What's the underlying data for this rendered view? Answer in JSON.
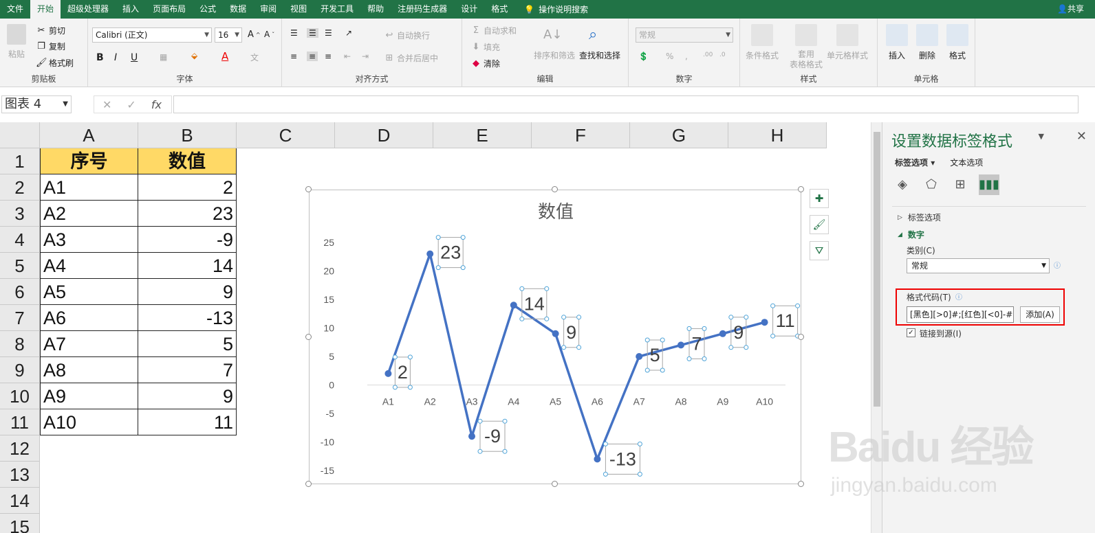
{
  "menu": {
    "tabs": [
      "文件",
      "开始",
      "超级处理器",
      "插入",
      "页面布局",
      "公式",
      "数据",
      "审阅",
      "视图",
      "开发工具",
      "帮助",
      "注册码生成器",
      "设计",
      "格式"
    ],
    "active_tab": "开始",
    "search": "操作说明搜索",
    "share": "共享"
  },
  "ribbon": {
    "clipboard": {
      "paste": "粘贴",
      "cut": "剪切",
      "copy": "复制",
      "format_painter": "格式刷",
      "name": "剪贴板"
    },
    "font": {
      "font_name": "Calibri (正文)",
      "font_size": "16",
      "bold": "B",
      "italic": "I",
      "underline": "U",
      "name": "字体"
    },
    "align": {
      "wrap": "自动换行",
      "merge": "合并后居中",
      "name": "对齐方式"
    },
    "edit": {
      "autosum": "自动求和",
      "fill": "填充",
      "clear": "清除",
      "sort": "排序和筛选",
      "find": "查找和选择",
      "name": "编辑"
    },
    "number": {
      "format": "常规",
      "name": "数字"
    },
    "styles": {
      "cond": "条件格式",
      "table": "套用\n表格格式",
      "cell": "单元格样式",
      "name": "样式"
    },
    "cells": {
      "insert": "插入",
      "delete": "删除",
      "format": "格式",
      "name": "单元格"
    }
  },
  "formula_bar": {
    "name_box": "图表 4",
    "fx": "fx",
    "value": ""
  },
  "sheet": {
    "columns": [
      "A",
      "B",
      "C",
      "D",
      "E",
      "F",
      "G",
      "H"
    ],
    "rows": [
      "1",
      "2",
      "3",
      "4",
      "5",
      "6",
      "7",
      "8",
      "9",
      "10",
      "11",
      "12",
      "13",
      "14",
      "15"
    ],
    "header": [
      "序号",
      "数值"
    ],
    "data": [
      [
        "A1",
        "2"
      ],
      [
        "A2",
        "23"
      ],
      [
        "A3",
        "-9"
      ],
      [
        "A4",
        "14"
      ],
      [
        "A5",
        "9"
      ],
      [
        "A6",
        "-13"
      ],
      [
        "A7",
        "5"
      ],
      [
        "A8",
        "7"
      ],
      [
        "A9",
        "9"
      ],
      [
        "A10",
        "11"
      ]
    ]
  },
  "chart_data": {
    "type": "line",
    "title": "数值",
    "categories": [
      "A1",
      "A2",
      "A3",
      "A4",
      "A5",
      "A6",
      "A7",
      "A8",
      "A9",
      "A10"
    ],
    "series": [
      {
        "values": [
          2,
          23,
          -9,
          14,
          9,
          -13,
          5,
          7,
          9,
          11
        ],
        "color": "#4472c4"
      }
    ],
    "ylim": [
      -15,
      25
    ],
    "yticks": [
      25,
      20,
      15,
      10,
      5,
      0,
      -5,
      -10,
      -15
    ],
    "data_labels": true,
    "grid": false
  },
  "pane": {
    "title": "设置数据标签格式",
    "tab_label_options": "标签选项",
    "tab_text_options": "文本选项",
    "section_label_options": "标签选项",
    "section_number": "数字",
    "category_label": "类别(C)",
    "category_value": "常规",
    "format_code_label": "格式代码(T)",
    "format_code_value": "[黑色][>0]#;[红色][<0]-#",
    "add_button": "添加(A)",
    "link_source": "链接到源(I)"
  },
  "watermark": {
    "main": "Baidu 经验",
    "sub": "jingyan.baidu.com"
  }
}
